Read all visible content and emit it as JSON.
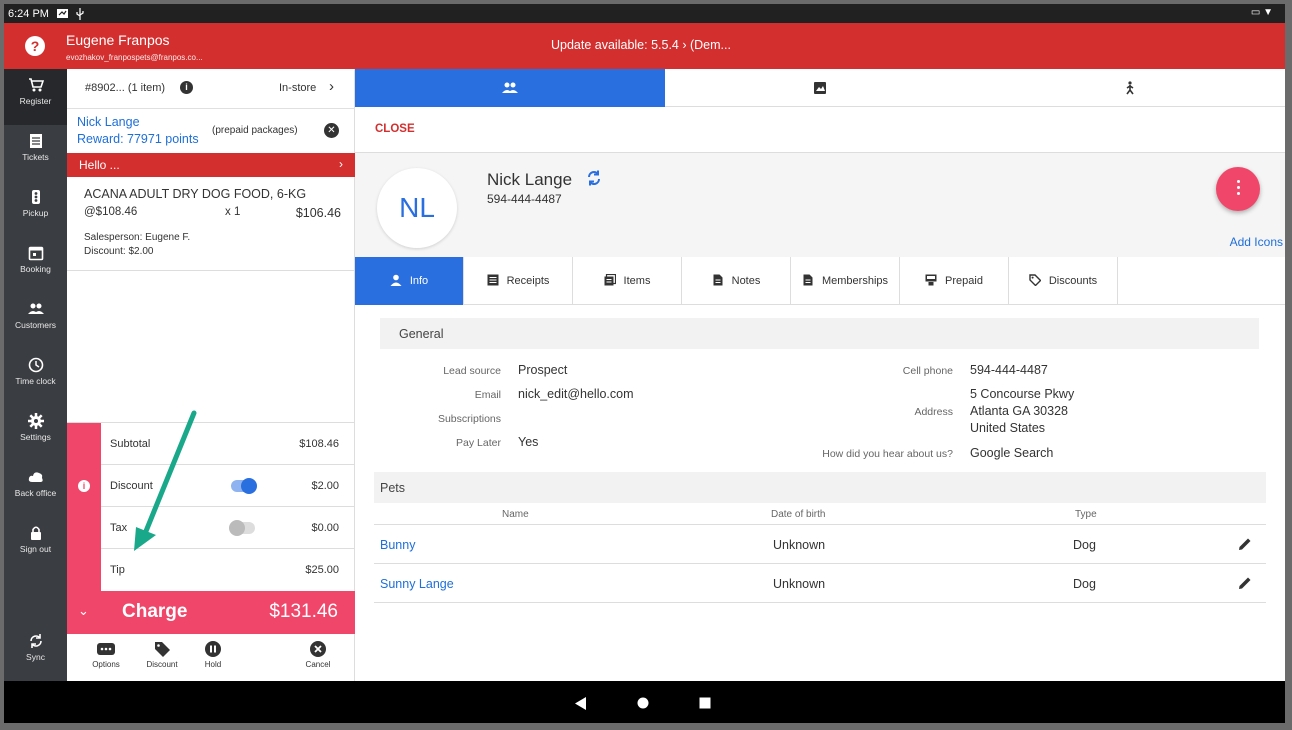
{
  "status_bar": {
    "time": "6:24 PM"
  },
  "header": {
    "user_name": "Eugene Franpos",
    "user_email": "evozhakov_franpospets@franpos.co...",
    "update_text": "Update available: 5.5.4 ›  (Dem...",
    "color": "#d32f2f"
  },
  "sidebar": {
    "items": [
      {
        "label": "Register",
        "icon": "cart-icon"
      },
      {
        "label": "Tickets",
        "icon": "ticket-icon"
      },
      {
        "label": "Pickup",
        "icon": "traffic-light-icon"
      },
      {
        "label": "Booking",
        "icon": "calendar-icon"
      },
      {
        "label": "Customers",
        "icon": "people-icon"
      },
      {
        "label": "Time clock",
        "icon": "clock-icon"
      },
      {
        "label": "Settings",
        "icon": "gear-icon"
      },
      {
        "label": "Back office",
        "icon": "cloud-icon"
      },
      {
        "label": "Sign out",
        "icon": "lock-icon"
      },
      {
        "label": "Sync",
        "icon": "sync-icon"
      }
    ]
  },
  "cart": {
    "order_id": "#8902... (1 item)",
    "order_type": "In-store",
    "customer_name": "Nick Lange",
    "reward": "Reward: 77971 points",
    "prepaid": "(prepaid packages)",
    "greeting": "Hello ...",
    "item": {
      "name": "ACANA ADULT DRY DOG FOOD, 6-KG",
      "unit_price": "@$108.46",
      "qty": "x  1",
      "total": "$106.46",
      "salesperson": "Salesperson: Eugene F.",
      "discount": "Discount: $2.00"
    },
    "totals": {
      "subtotal_label": "Subtotal",
      "subtotal": "$108.46",
      "discount_label": "Discount",
      "discount": "$2.00",
      "tax_label": "Tax",
      "tax": "$0.00",
      "tip_label": "Tip",
      "tip": "$25.00"
    },
    "charge_label": "Charge",
    "charge_amount": "$131.46",
    "accent": "#f0466a",
    "actions": {
      "options": "Options",
      "discount": "Discount",
      "hold": "Hold",
      "cancel": "Cancel"
    }
  },
  "main": {
    "close_label": "CLOSE",
    "initials": "NL",
    "name": "Nick Lange",
    "phone": "594-444-4487",
    "add_icons": "Add Icons",
    "subtabs": [
      "Info",
      "Receipts",
      "Items",
      "Notes",
      "Memberships",
      "Prepaid",
      "Discounts"
    ],
    "general_title": "General",
    "fields": {
      "lead_source_label": "Lead source",
      "lead_source": "Prospect",
      "email_label": "Email",
      "email": "nick_edit@hello.com",
      "subscriptions_label": "Subscriptions",
      "pay_later_label": "Pay Later",
      "pay_later": "Yes",
      "cell_phone_label": "Cell phone",
      "cell_phone": "594-444-4487",
      "address_label": "Address",
      "address_line1": "5 Concourse Pkwy",
      "address_line2": "Atlanta GA 30328",
      "address_line3": "United States",
      "heard_label": "How did you hear about us?",
      "heard": "Google Search"
    },
    "pets_title": "Pets",
    "pet_columns": {
      "name": "Name",
      "dob": "Date of birth",
      "type": "Type"
    },
    "pets": [
      {
        "name": "Bunny",
        "dob": "Unknown",
        "type": "Dog"
      },
      {
        "name": "Sunny Lange",
        "dob": "Unknown",
        "type": "Dog"
      }
    ],
    "accent": "#2a6fe0"
  }
}
